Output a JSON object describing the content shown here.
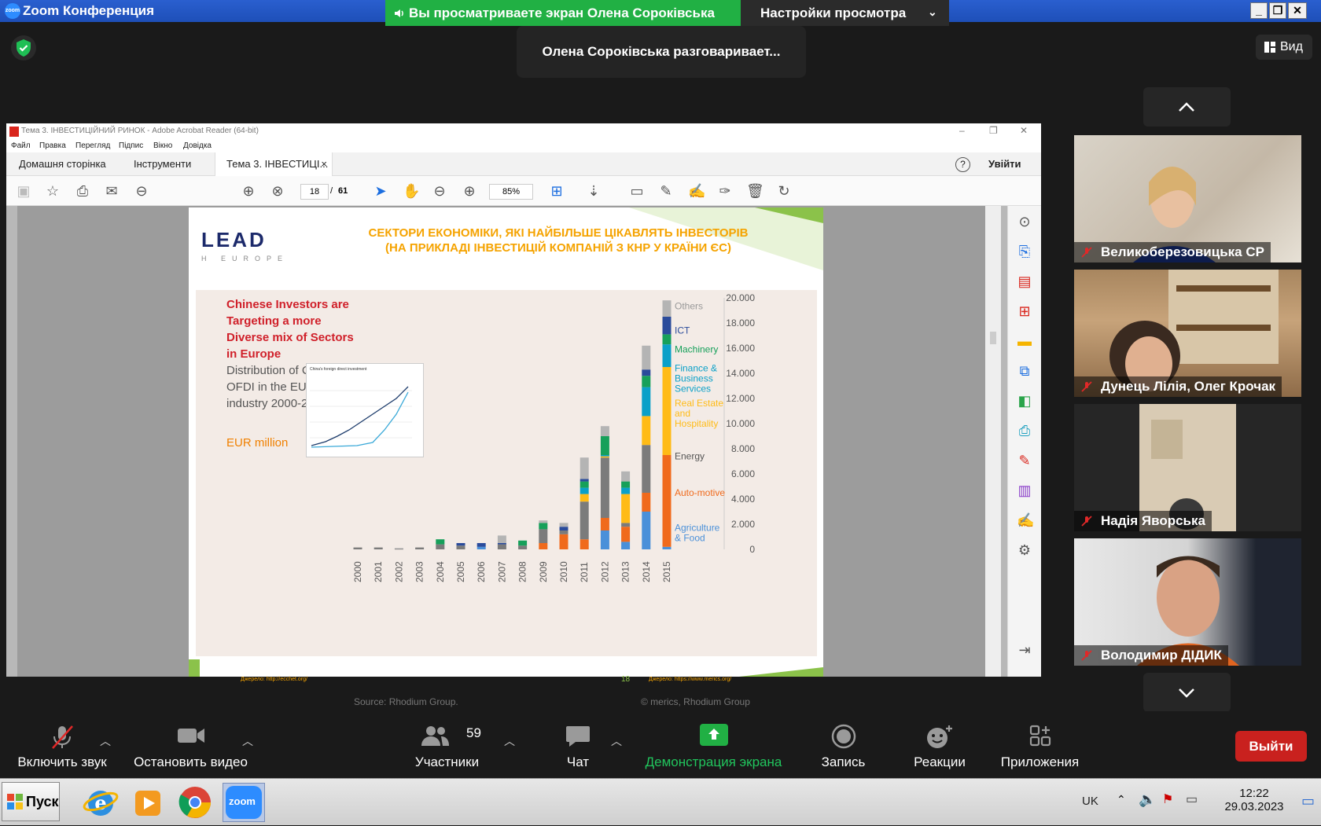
{
  "titlebar": {
    "app_title": "Zoom Конференция",
    "logo_text": "zoom"
  },
  "share_banner": {
    "text": "Вы просматриваете экран Олена Сороківська"
  },
  "view_settings": {
    "label": "Настройки просмотра"
  },
  "speaking_toast": "Олена Сороківська разговаривает...",
  "view_button": {
    "label": "Вид"
  },
  "acrobat": {
    "window_title": "Тема 3. ІНВЕСТИЦІЙНИЙ РИНОК - Adobe Acrobat Reader (64-bit)",
    "menu": [
      "Файл",
      "Правка",
      "Перегляд",
      "Підпис",
      "Вікно",
      "Довідка"
    ],
    "tabs": {
      "home": "Домашня сторінка",
      "tools": "Інструменти",
      "document": "Тема 3. ІНВЕСТИЦІ...",
      "close": "×"
    },
    "sign_in": "Увійти",
    "help": "?",
    "page_current": "18",
    "page_sep": "/",
    "page_total": "61",
    "zoom": "85%"
  },
  "slide": {
    "logo": "LEAD",
    "logo_sub": "H EUROPE",
    "heading_line1": "СЕКТОРИ ЕКОНОМІКИ, ЯКІ НАЙБІЛЬШЕ ЦІКАВЛЯТЬ ІНВЕСТОРІВ",
    "heading_line2": "(НА ПРИКЛАДІ ІНВЕСТИЦІЙ КОМПАНІЙ З КНР У КРАЇНИ ЄС)",
    "red_title": [
      "Chinese Investors are",
      "Targeting a more",
      "Diverse mix of Sectors",
      "in Europe"
    ],
    "subtitle": [
      "Distribution of Chinese",
      "OFDI in the EU-28 by",
      "industry 2000-2015"
    ],
    "unit": "EUR million",
    "thumb_title": "China's foreign direct investment",
    "source": "Source: Rhodium Group.",
    "copyright": "© merics, Rhodium Group",
    "page_number": "18",
    "link_left": "Джерело: http://ecchet.org/",
    "link_right": "Джерело: https://www.merics.org/"
  },
  "chart_data": {
    "type": "bar",
    "title": "",
    "xlabel": "",
    "ylabel": "",
    "stacked": true,
    "ylim": [
      0,
      20000
    ],
    "yticks": [
      "0",
      "2.000",
      "4.000",
      "6.000",
      "8.000",
      "10.000",
      "12.000",
      "14.000",
      "16.000",
      "18.000",
      "20.000"
    ],
    "categories": [
      "2000",
      "2001",
      "2002",
      "2003",
      "2004",
      "2005",
      "2006",
      "2007",
      "2008",
      "2009",
      "2010",
      "2011",
      "2012",
      "2013",
      "2014",
      "2015"
    ],
    "series": [
      {
        "name": "Agriculture & Food",
        "color": "#4a90d9",
        "values": [
          0,
          0,
          0,
          0,
          0,
          0,
          200,
          0,
          0,
          0,
          0,
          0,
          1500,
          600,
          3000,
          200
        ]
      },
      {
        "name": "Auto-motive",
        "color": "#f06a1c",
        "values": [
          0,
          0,
          0,
          0,
          0,
          0,
          0,
          0,
          0,
          500,
          1200,
          800,
          1000,
          1200,
          1500,
          7300
        ]
      },
      {
        "name": "Energy",
        "color": "#7b7b7b",
        "values": [
          150,
          150,
          50,
          150,
          400,
          300,
          0,
          400,
          300,
          1100,
          300,
          3000,
          4800,
          300,
          3800,
          0
        ]
      },
      {
        "name": "Real Estate and Hospitality",
        "color": "#ffbb16",
        "values": [
          0,
          0,
          0,
          0,
          0,
          0,
          0,
          0,
          0,
          0,
          0,
          600,
          100,
          2300,
          2300,
          7000
        ]
      },
      {
        "name": "Finance & Business Services",
        "color": "#0aa0c8",
        "values": [
          0,
          0,
          0,
          0,
          0,
          0,
          0,
          0,
          0,
          0,
          0,
          500,
          100,
          500,
          2300,
          1800
        ]
      },
      {
        "name": "Machinery",
        "color": "#16a05a",
        "values": [
          0,
          0,
          0,
          0,
          400,
          0,
          0,
          0,
          400,
          500,
          0,
          500,
          1500,
          500,
          900,
          800
        ]
      },
      {
        "name": "ICT",
        "color": "#2a4b9b",
        "values": [
          0,
          0,
          0,
          0,
          0,
          200,
          300,
          100,
          0,
          0,
          300,
          200,
          0,
          0,
          500,
          1400
        ]
      },
      {
        "name": "Others",
        "color": "#b4b4b4",
        "values": [
          0,
          0,
          50,
          0,
          0,
          0,
          0,
          600,
          0,
          200,
          300,
          1700,
          800,
          800,
          1900,
          1300
        ]
      }
    ],
    "legend_position": "right"
  },
  "tiles": [
    {
      "name": "Великоберезовицька СР"
    },
    {
      "name": "Дунець Лілія, Олег Крочак"
    },
    {
      "name": "Надія Яворська"
    },
    {
      "name": "Володимир ДІДИК"
    }
  ],
  "toolbar": {
    "mute": "Включить звук",
    "video": "Остановить видео",
    "participants": "Участники",
    "participants_count": "59",
    "chat": "Чат",
    "share": "Демонстрация экрана",
    "record": "Запись",
    "reactions": "Реакции",
    "apps": "Приложения",
    "leave": "Выйти"
  },
  "taskbar": {
    "start": "Пуск",
    "lang": "UK",
    "time": "12:22",
    "date": "29.03.2023",
    "zoom_label": "zoom"
  }
}
